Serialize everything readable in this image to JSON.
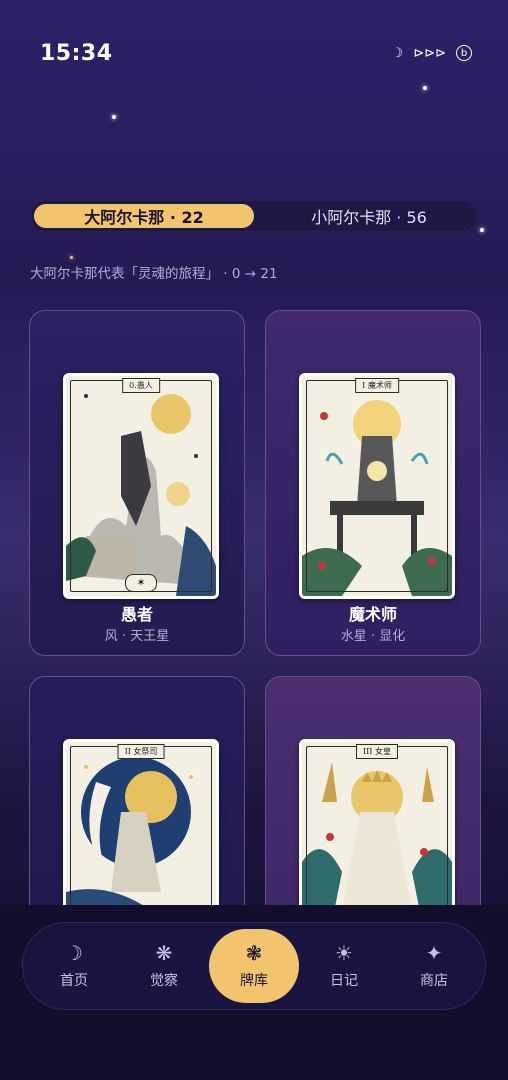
{
  "status": {
    "time": "15:34",
    "icons": [
      "moon-icon",
      "signal-icon",
      "b-icon"
    ]
  },
  "tabs": {
    "major": "大阿尔卡那 · 22",
    "minor": "小阿尔卡那 · 56"
  },
  "description": "大阿尔卡那代表「灵魂的旅程」 · 0 → 21",
  "cards": [
    {
      "label": "0.愚人",
      "name": "愚者",
      "sub": "风 · 天王星"
    },
    {
      "label": "I 魔术师",
      "name": "魔术师",
      "sub": "水星 · 显化"
    },
    {
      "label": "II 女祭司",
      "name": "",
      "sub": ""
    },
    {
      "label": "III 女皇",
      "name": "",
      "sub": ""
    }
  ],
  "nav": [
    {
      "icon": "moon-icon",
      "label": "首页"
    },
    {
      "icon": "sparkle-icon",
      "label": "觉察"
    },
    {
      "icon": "flower-icon",
      "label": "牌库"
    },
    {
      "icon": "sun-icon",
      "label": "日记"
    },
    {
      "icon": "star-icon",
      "label": "商店"
    }
  ],
  "colors": {
    "accent": "#f2c46d",
    "bg": "#2a1f5e"
  }
}
